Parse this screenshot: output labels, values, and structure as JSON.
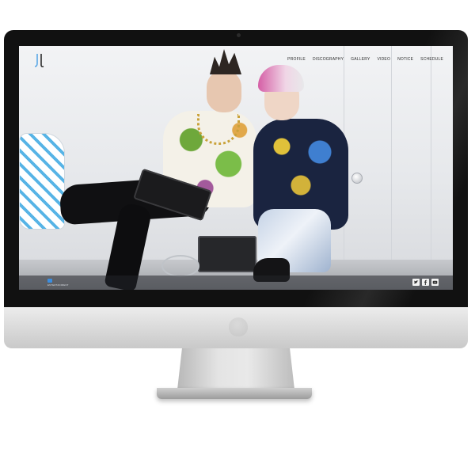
{
  "site": {
    "logo_icon": "agency-logo-icon",
    "nav": [
      {
        "label": "PROFILE"
      },
      {
        "label": "DISCOGRAPHY"
      },
      {
        "label": "GALLERY"
      },
      {
        "label": "VIDEO"
      },
      {
        "label": "NOTICE"
      },
      {
        "label": "SCHEDULE"
      }
    ],
    "footer": {
      "logo_text": "ENTERTAINMENT",
      "social": [
        {
          "icon": "twitter-icon"
        },
        {
          "icon": "facebook-icon"
        },
        {
          "icon": "youtube-icon"
        }
      ]
    }
  },
  "colors": {
    "bezel": "#111111",
    "chin": "#dcdcdc",
    "accent_blue": "#3b8ee0",
    "nav_text": "#2c2c2c"
  }
}
